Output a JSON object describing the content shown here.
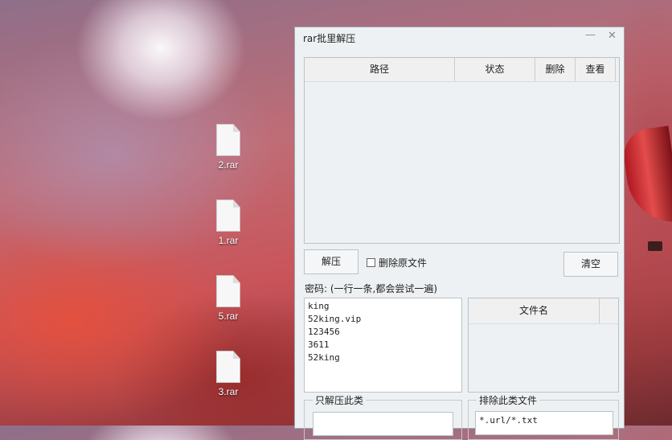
{
  "desktop": {
    "icons": [
      {
        "label": "2.rar"
      },
      {
        "label": "1.rar"
      },
      {
        "label": "5.rar"
      },
      {
        "label": "3.rar"
      }
    ]
  },
  "window": {
    "title": "rar批里解压",
    "minimize_glyph": "—",
    "close_glyph": "✕",
    "table": {
      "columns": [
        "路径",
        "状态",
        "删除",
        "查看"
      ]
    },
    "extract_button": "解压",
    "delete_original_label": "删除原文件",
    "delete_original_checked": false,
    "clear_button": "清空",
    "password_label": "密码: (一行一条,都会尝试一遍)",
    "passwords": [
      "king",
      "52king.vip",
      "123456",
      "3611",
      "52king"
    ],
    "filename_column": "文件名",
    "only_extract_label": "只解压此类",
    "only_extract_value": "",
    "exclude_label": "排除此类文件",
    "exclude_value": "*.url/*.txt"
  }
}
